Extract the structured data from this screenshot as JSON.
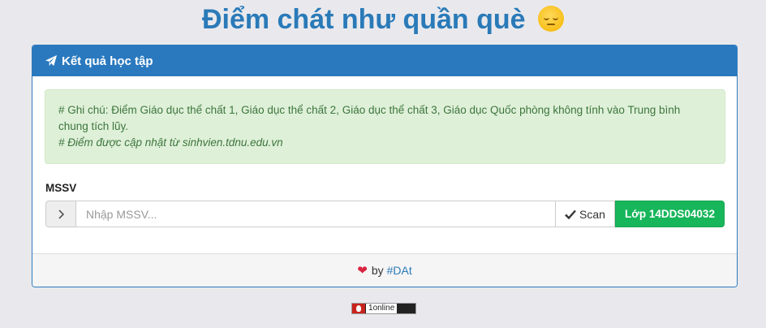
{
  "page": {
    "title": "Điểm chát như quần què",
    "emoji": "pensive-face"
  },
  "panel": {
    "heading": "Kết quả học tập",
    "heading_icon": "paper-plane-icon"
  },
  "alert": {
    "note_line": "# Ghi chú: Điểm Giáo dục thể chất 1, Giáo dục thể chất 2, Giáo dục thể chất 3, Giáo dục Quốc phòng không tính vào Trung bình chung tích lũy.",
    "update_line": "# Điểm được cập nhật từ sinhvien.tdnu.edu.vn"
  },
  "form": {
    "label": "MSSV",
    "placeholder": "Nhập MSSV...",
    "scan_label": "Scan",
    "class_button_label": "Lớp 14DDS04032"
  },
  "footer": {
    "by_text": "by",
    "author": "#DAt"
  },
  "counter": {
    "count": "1",
    "label": "online"
  },
  "colors": {
    "title": "#2a7ab8",
    "panel_heading": "#2a79bf",
    "alert_bg": "#dff0d8",
    "alert_text": "#3c763d",
    "class_button": "#18b65b",
    "heart": "#d9233f"
  }
}
